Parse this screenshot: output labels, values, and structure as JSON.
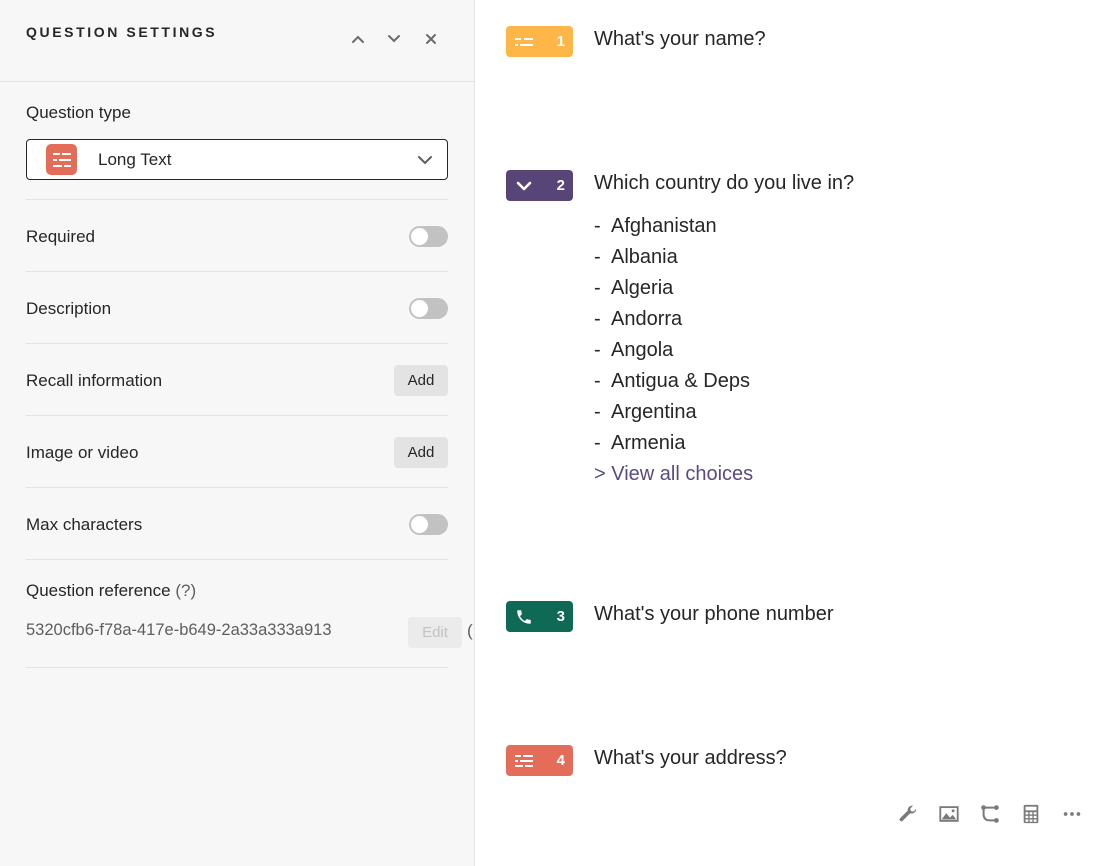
{
  "settings_panel": {
    "title": "QUESTION SETTINGS",
    "header_buttons": [
      "chevron-up-icon",
      "chevron-down-icon",
      "close-icon"
    ],
    "question_type": {
      "label": "Question type",
      "selected": "Long Text",
      "icon": "long-text-icon",
      "icon_color": "#e36d59"
    },
    "rows": [
      {
        "label": "Required",
        "control": "toggle",
        "on": false
      },
      {
        "label": "Description",
        "control": "toggle",
        "on": false
      },
      {
        "label": "Recall information",
        "control": "button",
        "button_label": "Add"
      },
      {
        "label": "Image or video",
        "control": "button",
        "button_label": "Add"
      },
      {
        "label": "Max characters",
        "control": "toggle",
        "on": false
      }
    ],
    "question_reference": {
      "label": "Question reference",
      "hint": "(?)",
      "value": "5320cfb6-f78a-417e-b649-2a33a333a913",
      "edit_label": "Edit",
      "trailing": "("
    }
  },
  "preview": {
    "questions": [
      {
        "number": "1",
        "type_icon": "short-text-icon",
        "color": "#ffb648",
        "text": "What's your name?"
      },
      {
        "number": "2",
        "type_icon": "dropdown-icon",
        "color": "#584578",
        "text": "Which country do you live in?",
        "choices": [
          "Afghanistan",
          "Albania",
          "Algeria",
          "Andorra",
          "Angola",
          "Antigua & Deps",
          "Argentina",
          "Armenia"
        ],
        "view_all": "> View all choices"
      },
      {
        "number": "3",
        "type_icon": "phone-icon",
        "color": "#0e6a55",
        "text": "What's your phone number"
      },
      {
        "number": "4",
        "type_icon": "long-text-icon",
        "color": "#e36d59",
        "text": "What's your address?"
      }
    ],
    "toolbar": [
      "wrench-icon",
      "image-icon",
      "logic-branch-icon",
      "calculator-icon",
      "more-icon"
    ]
  }
}
